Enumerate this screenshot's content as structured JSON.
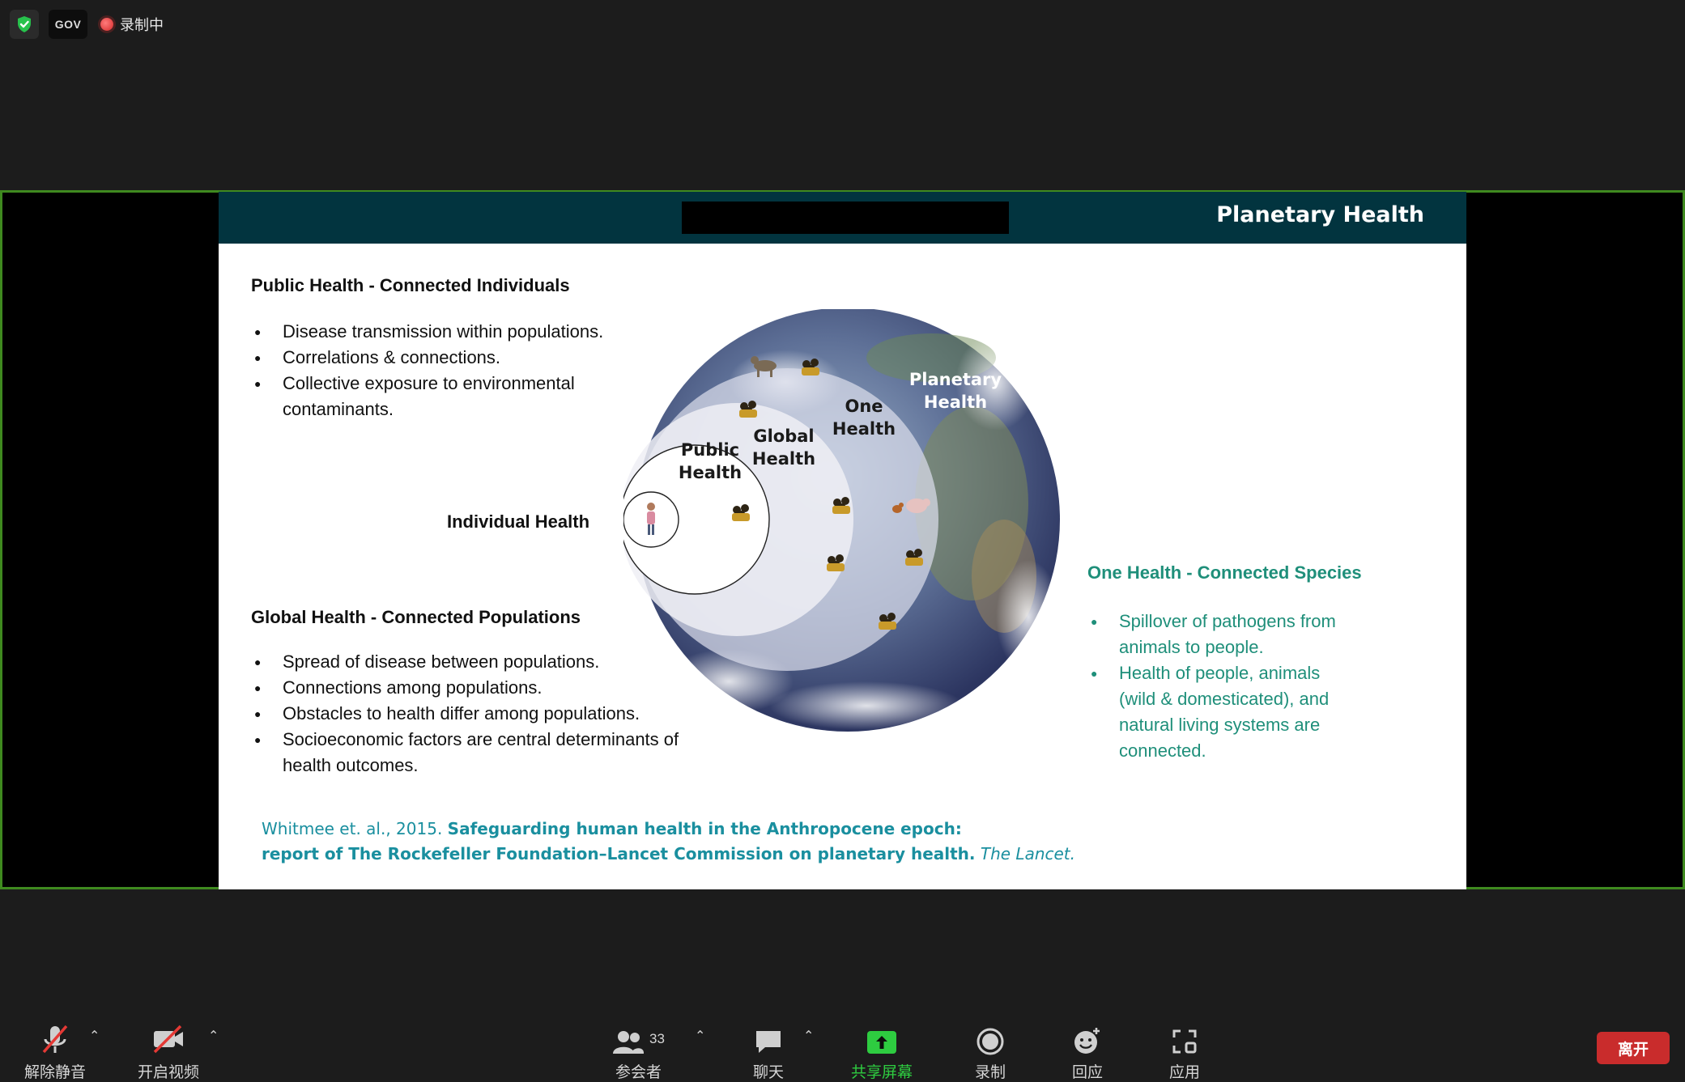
{
  "status": {
    "gov": "GOV",
    "recording": "录制中"
  },
  "slide": {
    "title": "Planetary Health",
    "public_heading": "Public Health - Connected Individuals",
    "public_items": [
      "Disease transmission within populations.",
      "Correlations & connections.",
      "Collective exposure to environmental contaminants."
    ],
    "individual_label": "Individual Health",
    "global_heading": "Global Health - Connected Populations",
    "global_items": [
      "Spread of disease between populations.",
      "Connections among populations.",
      "Obstacles to health differ among populations.",
      "Socioeconomic factors are central determinants of health outcomes."
    ],
    "one_heading": "One Health - Connected Species",
    "one_items": [
      "Spillover of pathogens from animals to people.",
      "Health of people, animals (wild & domesticated), and natural living systems are connected."
    ],
    "diagram": {
      "planetary": [
        "Planetary",
        "Health"
      ],
      "one": [
        "One",
        "Health"
      ],
      "global": [
        "Global",
        "Health"
      ],
      "public": [
        "Public",
        "Health"
      ]
    },
    "citation": {
      "authors": "Whitmee et. al., 2015.",
      "title_line1": "Safeguarding human health in the Anthropocene epoch:",
      "title_line2": "report of The Rockefeller Foundation–Lancet Commission on planetary health.",
      "journal": "The Lancet."
    }
  },
  "toolbar": {
    "unmute": "解除静音",
    "start_video": "开启视频",
    "participants": "参会者",
    "participants_count": "33",
    "chat": "聊天",
    "share": "共享屏幕",
    "record": "录制",
    "reactions": "回应",
    "apps": "应用",
    "leave": "离开"
  },
  "colors": {
    "share_border": "#3f8a1f",
    "slide_header": "#02343f",
    "one_health_green": "#1f8f7a",
    "citation": "#1a8f9f",
    "share_icon": "#2ecc40",
    "leave": "#c92c2c"
  }
}
